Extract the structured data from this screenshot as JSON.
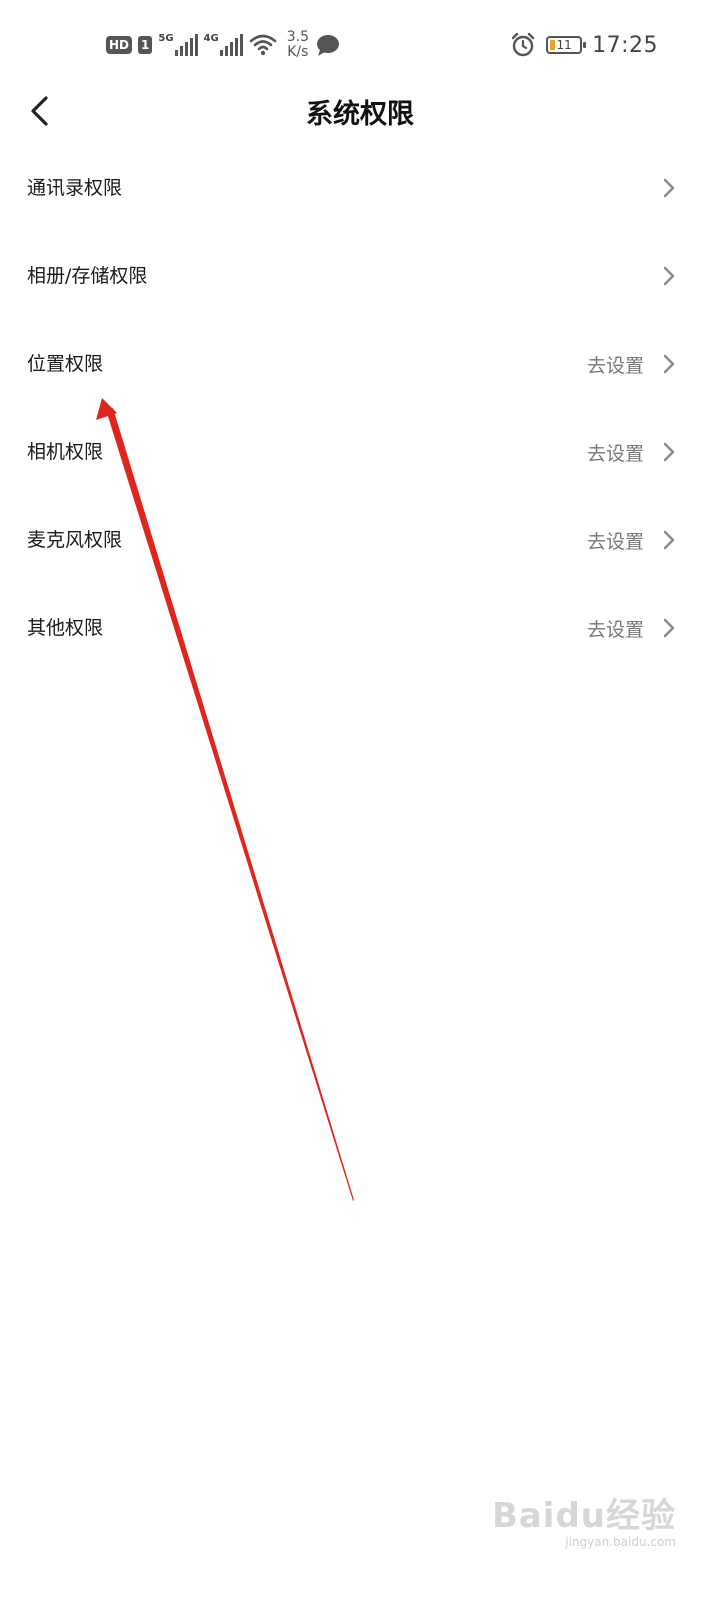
{
  "status_bar": {
    "hd_label": "HD",
    "sim_label": "1",
    "net1_type": "5G",
    "net2_type": "4G",
    "speed_value": "3.5",
    "speed_unit": "K/s",
    "battery_level": "11",
    "time": "17:25",
    "icons": [
      "wifi-icon",
      "message-icon",
      "alarm-icon",
      "battery-icon"
    ]
  },
  "header": {
    "title": "系统权限",
    "back_icon": "back-arrow-icon"
  },
  "permissions": [
    {
      "label": "通讯录权限",
      "action": ""
    },
    {
      "label": "相册/存储权限",
      "action": ""
    },
    {
      "label": "位置权限",
      "action": "去设置"
    },
    {
      "label": "相机权限",
      "action": "去设置"
    },
    {
      "label": "麦克风权限",
      "action": "去设置"
    },
    {
      "label": "其他权限",
      "action": "去设置"
    }
  ],
  "annotation": {
    "color": "#e0261c"
  },
  "watermark": {
    "logo": "Baidu经验",
    "url": "jingyan.baidu.com"
  },
  "colors": {
    "background": "#ffffff",
    "text_primary": "#1a1a1a",
    "text_secondary": "#777777",
    "chevron": "#888888"
  }
}
